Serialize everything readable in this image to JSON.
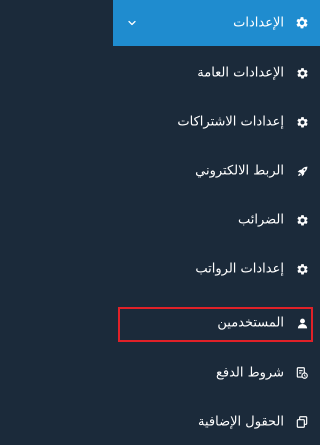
{
  "sidebar": {
    "header": {
      "label": "الإعدادات",
      "icon": "gear-icon",
      "chevron": "chevron-down-icon"
    },
    "items": [
      {
        "label": "الإعدادات العامة",
        "icon": "gear-icon"
      },
      {
        "label": "إعدادات الاشتراكات",
        "icon": "gear-icon"
      },
      {
        "label": "الربط الالكتروني",
        "icon": "rocket-icon"
      },
      {
        "label": "الضرائب",
        "icon": "gear-icon"
      },
      {
        "label": "إعدادات الرواتب",
        "icon": "gear-icon"
      },
      {
        "label": "المستخدمين",
        "icon": "user-icon",
        "selected": true
      },
      {
        "label": "شروط الدفع",
        "icon": "payment-terms-icon"
      },
      {
        "label": "الحقول الإضافية",
        "icon": "copy-icon"
      }
    ]
  },
  "colors": {
    "sidebar_bg": "#1b2a3a",
    "header_bg": "#1f8ccf",
    "highlight_border": "#e02128",
    "text": "#ffffff"
  }
}
